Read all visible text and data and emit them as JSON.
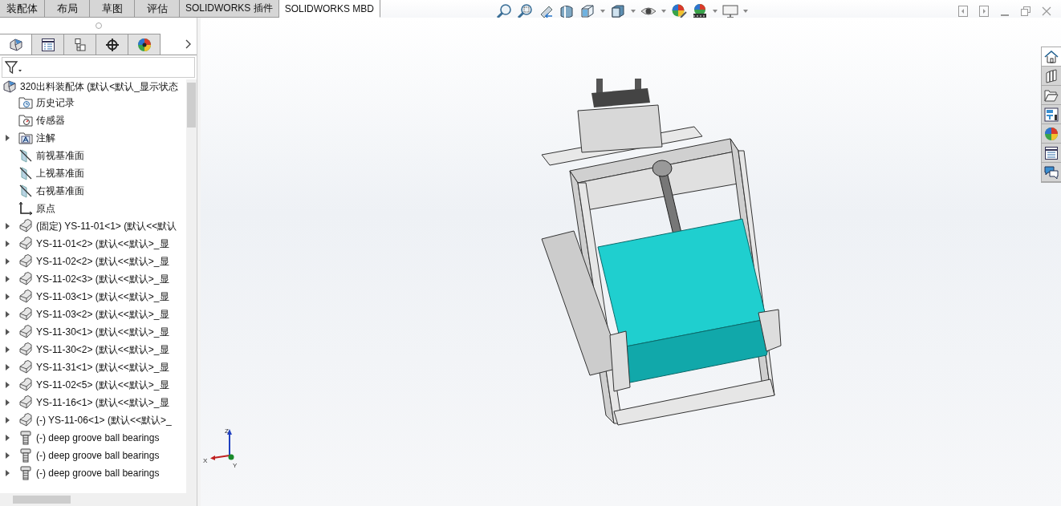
{
  "tabs": [
    {
      "label": "装配体",
      "selected": false
    },
    {
      "label": "布局",
      "selected": false
    },
    {
      "label": "草图",
      "selected": false
    },
    {
      "label": "评估",
      "selected": false
    },
    {
      "label": "SOLIDWORKS 插件",
      "selected": false
    },
    {
      "label": "SOLIDWORKS MBD",
      "selected": true
    }
  ],
  "panel_tabs": [
    {
      "kind": "tree",
      "selected": true
    },
    {
      "kind": "property",
      "selected": false
    },
    {
      "kind": "config",
      "selected": false
    },
    {
      "kind": "dim",
      "selected": false
    },
    {
      "kind": "display",
      "selected": false
    }
  ],
  "tree": {
    "root": "320出料装配体  (默认<默认_显示状态",
    "items": [
      {
        "kind": "history",
        "label": "历史记录",
        "expandable": false
      },
      {
        "kind": "sensor",
        "label": "传感器",
        "expandable": false
      },
      {
        "kind": "annotation",
        "label": "注解",
        "expandable": true
      },
      {
        "kind": "plane",
        "label": "前视基准面",
        "expandable": false
      },
      {
        "kind": "plane",
        "label": "上视基准面",
        "expandable": false
      },
      {
        "kind": "plane",
        "label": "右视基准面",
        "expandable": false
      },
      {
        "kind": "origin",
        "label": "原点",
        "expandable": false
      },
      {
        "kind": "part",
        "label": "(固定) YS-11-01<1>  (默认<<默认",
        "expandable": true
      },
      {
        "kind": "part",
        "label": "YS-11-01<2>  (默认<<默认>_显",
        "expandable": true
      },
      {
        "kind": "part",
        "label": "YS-11-02<2>  (默认<<默认>_显",
        "expandable": true
      },
      {
        "kind": "part",
        "label": "YS-11-02<3>  (默认<<默认>_显",
        "expandable": true
      },
      {
        "kind": "part",
        "label": "YS-11-03<1>  (默认<<默认>_显",
        "expandable": true
      },
      {
        "kind": "part",
        "label": "YS-11-03<2>  (默认<<默认>_显",
        "expandable": true
      },
      {
        "kind": "part",
        "label": "YS-11-30<1>  (默认<<默认>_显",
        "expandable": true
      },
      {
        "kind": "part",
        "label": "YS-11-30<2>  (默认<<默认>_显",
        "expandable": true
      },
      {
        "kind": "part",
        "label": "YS-11-31<1>  (默认<<默认>_显",
        "expandable": true
      },
      {
        "kind": "part",
        "label": "YS-11-02<5>  (默认<<默认>_显",
        "expandable": true
      },
      {
        "kind": "part",
        "label": "YS-11-16<1>  (默认<<默认>_显",
        "expandable": true
      },
      {
        "kind": "part",
        "label": "(-) YS-11-06<1>  (默认<<默认>_",
        "expandable": true
      },
      {
        "kind": "bearing",
        "label": "(-) deep groove ball bearings",
        "expandable": true
      },
      {
        "kind": "bearing",
        "label": "(-) deep groove ball bearings",
        "expandable": true
      },
      {
        "kind": "bearing",
        "label": "(-) deep groove ball bearings",
        "expandable": true
      }
    ]
  },
  "task_pane": [
    {
      "kind": "home",
      "selected": true
    },
    {
      "kind": "library",
      "selected": false
    },
    {
      "kind": "files",
      "selected": false
    },
    {
      "kind": "views",
      "selected": false
    },
    {
      "kind": "appearance",
      "selected": false
    },
    {
      "kind": "properties",
      "selected": false
    },
    {
      "kind": "forum",
      "selected": false
    }
  ],
  "triad": {
    "x": "X",
    "y": "Y",
    "z": "Z"
  }
}
